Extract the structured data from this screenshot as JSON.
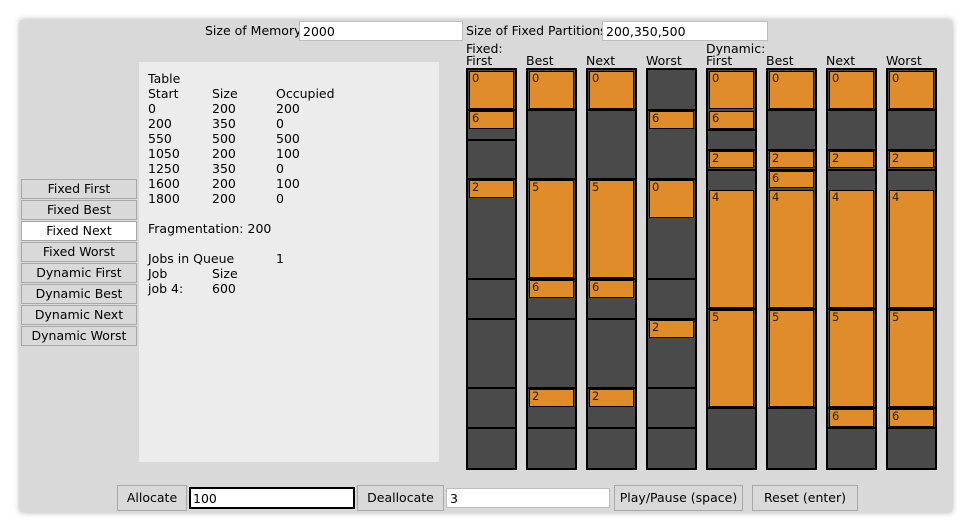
{
  "memory": {
    "label": "Size of Memory",
    "value": "2000"
  },
  "partitions": {
    "label": "Size of Fixed Partitions",
    "value": "200,350,500"
  },
  "algorithms": [
    "Fixed First",
    "Fixed Best",
    "Fixed Next",
    "Fixed Worst",
    "Dynamic First",
    "Dynamic Best",
    "Dynamic Next",
    "Dynamic Worst"
  ],
  "active_algorithm": "Fixed Next",
  "table": {
    "title": "Table",
    "headers": [
      "Start",
      "Size",
      "Occupied"
    ],
    "rows": [
      [
        "0",
        "200",
        "200"
      ],
      [
        "200",
        "350",
        "0"
      ],
      [
        "550",
        "500",
        "500"
      ],
      [
        "1050",
        "200",
        "100"
      ],
      [
        "1250",
        "350",
        "0"
      ],
      [
        "1600",
        "200",
        "100"
      ],
      [
        "1800",
        "200",
        "0"
      ]
    ],
    "fragmentation_label": "Fragmentation:",
    "fragmentation_value": "200",
    "queue_label": "Jobs in Queue",
    "queue_value": "1",
    "job_headers": [
      "Job",
      "Size"
    ],
    "jobs": [
      [
        "job 4:",
        "600"
      ]
    ]
  },
  "group_labels": {
    "fixed": "Fixed:",
    "dynamic": "Dynamic:"
  },
  "columns": [
    {
      "name": "First",
      "group": "fixed",
      "dividers": [
        200,
        350,
        550,
        1050,
        1250,
        1600,
        1800
      ],
      "blocks": [
        {
          "label": "0",
          "start": 0,
          "size": 200
        },
        {
          "label": "6",
          "start": 200,
          "size": 100
        },
        {
          "label": "2",
          "start": 550,
          "size": 100
        }
      ]
    },
    {
      "name": "Best",
      "group": "fixed",
      "dividers": [
        200,
        550,
        1050,
        1250,
        1600,
        1800
      ],
      "blocks": [
        {
          "label": "0",
          "start": 0,
          "size": 200
        },
        {
          "label": "5",
          "start": 550,
          "size": 500
        },
        {
          "label": "6",
          "start": 1050,
          "size": 100
        },
        {
          "label": "2",
          "start": 1600,
          "size": 100
        }
      ]
    },
    {
      "name": "Next",
      "group": "fixed",
      "dividers": [
        200,
        550,
        1050,
        1250,
        1600,
        1800
      ],
      "blocks": [
        {
          "label": "0",
          "start": 0,
          "size": 200
        },
        {
          "label": "5",
          "start": 550,
          "size": 500
        },
        {
          "label": "6",
          "start": 1050,
          "size": 100
        },
        {
          "label": "2",
          "start": 1600,
          "size": 100
        }
      ]
    },
    {
      "name": "Worst",
      "group": "fixed",
      "dividers": [
        200,
        550,
        1050,
        1250,
        1600,
        1800
      ],
      "blocks": [
        {
          "label": "6",
          "start": 200,
          "size": 100
        },
        {
          "label": "0",
          "start": 550,
          "size": 200
        },
        {
          "label": "2",
          "start": 1250,
          "size": 100
        }
      ]
    },
    {
      "name": "First",
      "group": "dynamic",
      "dividers": [
        300,
        400,
        500,
        1200,
        1700
      ],
      "blocks": [
        {
          "label": "0",
          "start": 0,
          "size": 200
        },
        {
          "label": "6",
          "start": 200,
          "size": 100
        },
        {
          "label": "2",
          "start": 400,
          "size": 100
        },
        {
          "label": "4",
          "start": 600,
          "size": 600
        },
        {
          "label": "5",
          "start": 1200,
          "size": 500
        }
      ]
    },
    {
      "name": "Best",
      "group": "dynamic",
      "dividers": [
        200,
        400,
        500,
        1200,
        1700
      ],
      "blocks": [
        {
          "label": "0",
          "start": 0,
          "size": 200
        },
        {
          "label": "2",
          "start": 400,
          "size": 100
        },
        {
          "label": "6",
          "start": 500,
          "size": 100
        },
        {
          "label": "4",
          "start": 600,
          "size": 600
        },
        {
          "label": "5",
          "start": 1200,
          "size": 500
        }
      ]
    },
    {
      "name": "Next",
      "group": "dynamic",
      "dividers": [
        200,
        400,
        500,
        1200,
        1700,
        1800
      ],
      "blocks": [
        {
          "label": "0",
          "start": 0,
          "size": 200
        },
        {
          "label": "2",
          "start": 400,
          "size": 100
        },
        {
          "label": "4",
          "start": 600,
          "size": 600
        },
        {
          "label": "5",
          "start": 1200,
          "size": 500
        },
        {
          "label": "6",
          "start": 1700,
          "size": 100
        }
      ]
    },
    {
      "name": "Worst",
      "group": "dynamic",
      "dividers": [
        200,
        400,
        500,
        1200,
        1700,
        1800
      ],
      "blocks": [
        {
          "label": "0",
          "start": 0,
          "size": 200
        },
        {
          "label": "2",
          "start": 400,
          "size": 100
        },
        {
          "label": "4",
          "start": 600,
          "size": 600
        },
        {
          "label": "5",
          "start": 1200,
          "size": 500
        },
        {
          "label": "6",
          "start": 1700,
          "size": 100
        }
      ]
    }
  ],
  "bottom": {
    "allocate_label": "Allocate",
    "allocate_value": "100",
    "deallocate_label": "Deallocate",
    "deallocate_value": "3",
    "play_label": "Play/Pause (space)",
    "reset_label": "Reset (enter)"
  },
  "colors": {
    "block": "#e08c2a",
    "free": "#4a4a4a",
    "active_button": "#ffffff"
  }
}
